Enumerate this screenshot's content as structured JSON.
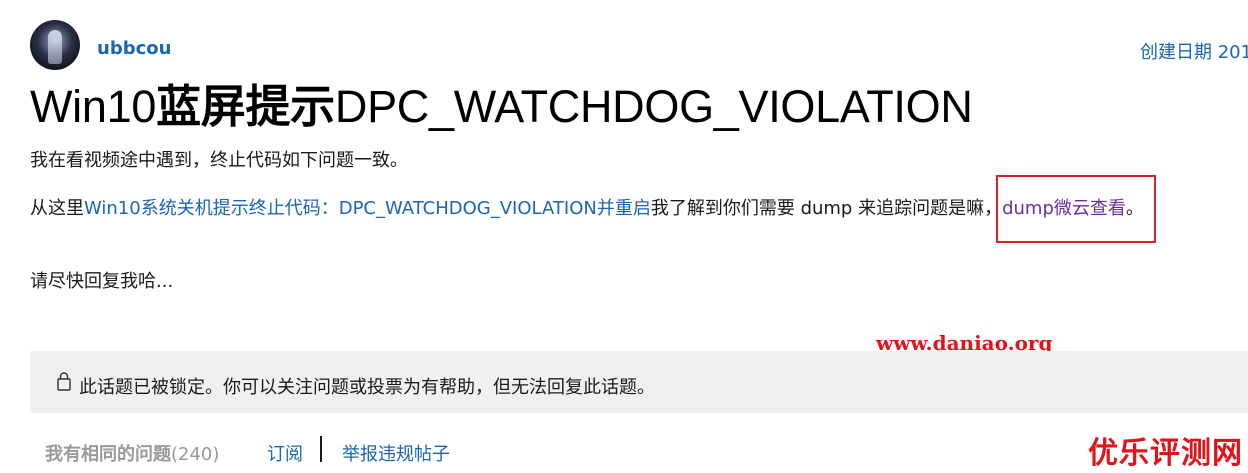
{
  "author": {
    "avatar_icon": "user-avatar",
    "username": "ubbcou"
  },
  "created_label": "创建日期 201",
  "title": {
    "prefix": "Win10",
    "cjk": "蓝屏提示",
    "suffix": "DPC_WATCHDOG_VIOLATION"
  },
  "body": {
    "para1": "我在看视频途中遇到，终止代码如下问题一致。",
    "para2_before": "从这里",
    "para2_link": "Win10系统关机提示终止代码：DPC_WATCHDOG_VIOLATION并重启",
    "para2_middle": "我了解到你们需要 dump 来追踪问题是嘛，",
    "para2_link2": "dump微云查看",
    "para2_end": "。",
    "para3": "请尽快回复我哈..."
  },
  "watermarks": {
    "site": "www.daniao.org",
    "brand": "优乐评测网"
  },
  "locked": {
    "icon": "lock-icon",
    "text": "此话题已被锁定。你可以关注问题或投票为有帮助，但无法回复此话题。"
  },
  "footer": {
    "same_question": "我有相同的问题",
    "same_count": "(240)",
    "subscribe": "订阅",
    "report": "举报违规帖子"
  },
  "colors": {
    "link": "#1a66b3",
    "visited_link": "#6b2fa0",
    "highlight_box": "#d6202a",
    "watermark": "#e0141b",
    "locked_bg": "#f0f0f0"
  }
}
